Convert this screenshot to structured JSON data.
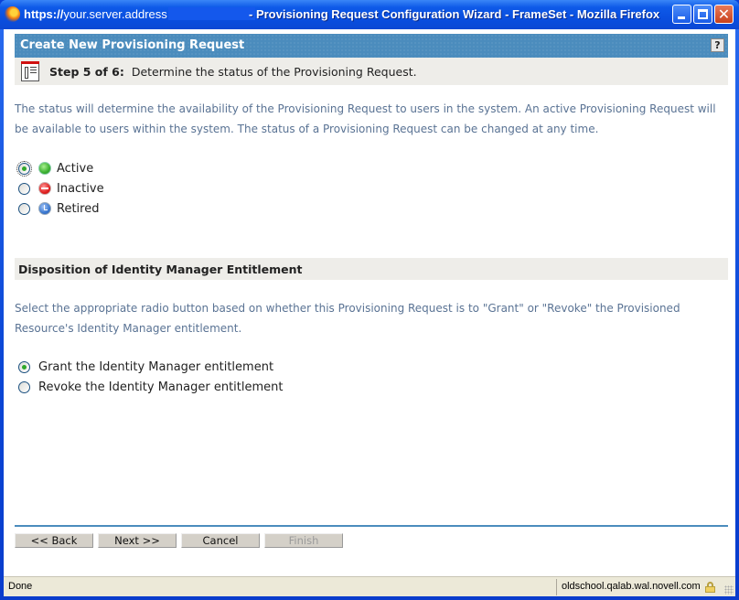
{
  "window": {
    "url_scheme": "https://",
    "url_host": "your.server.address",
    "title": "- Provisioning Request Configuration Wizard - FrameSet - Mozilla Firefox",
    "controls": {
      "minimize": "minimize",
      "maximize": "maximize",
      "close": "✕"
    }
  },
  "panel": {
    "title": "Create New Provisioning Request",
    "help_label": "?"
  },
  "step": {
    "prefix": "Step 5 of 6:",
    "text": "Determine the status of the Provisioning Request."
  },
  "status_section": {
    "description": "The status will determine the availability of the Provisioning Request to users in the system.  An active Provisioning Request will be available to users within the system.  The status of a Provisioning Request can be changed at any time.",
    "options": [
      {
        "label": "Active",
        "icon": "active-status-icon",
        "checked": true
      },
      {
        "label": "Inactive",
        "icon": "inactive-status-icon",
        "checked": false
      },
      {
        "label": "Retired",
        "icon": "retired-status-icon",
        "checked": false
      }
    ]
  },
  "disposition_section": {
    "title": "Disposition of Identity Manager Entitlement",
    "description": "Select the appropriate radio button based on whether this Provisioning Request is to \"Grant\" or \"Revoke\" the Provisioned Resource's Identity Manager entitlement.",
    "options": [
      {
        "label": "Grant the Identity Manager entitlement",
        "checked": true
      },
      {
        "label": "Revoke the Identity Manager entitlement",
        "checked": false
      }
    ]
  },
  "buttons": {
    "back": "<< Back",
    "next": "Next >>",
    "cancel": "Cancel",
    "finish": "Finish",
    "finish_enabled": false
  },
  "statusbar": {
    "status": "Done",
    "host": "oldschool.qalab.wal.novell.com",
    "secure_icon": "lock-icon"
  },
  "colors": {
    "accent": "#4b8cbd",
    "description_text": "#5a7394",
    "section_bg": "#eeede9"
  }
}
